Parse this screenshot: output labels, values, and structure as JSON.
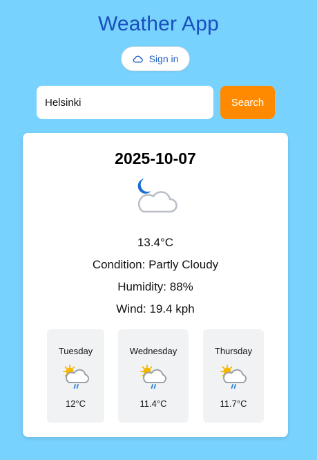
{
  "app": {
    "title": "Weather App",
    "signin_label": "Sign in"
  },
  "search": {
    "value": "Helsinki",
    "button_label": "Search"
  },
  "current": {
    "date": "2025-10-07",
    "icon": "moon-cloud-icon",
    "temperature": "13.4°C",
    "condition": "Condition: Partly Cloudy",
    "humidity": "Humidity: 88%",
    "wind": "Wind: 19.4 kph"
  },
  "forecast": [
    {
      "day": "Tuesday",
      "temp": "12°C",
      "icon": "sun-cloud-rain-icon"
    },
    {
      "day": "Wednesday",
      "temp": "11.4°C",
      "icon": "sun-cloud-rain-icon"
    },
    {
      "day": "Thursday",
      "temp": "11.7°C",
      "icon": "sun-cloud-rain-icon"
    }
  ],
  "colors": {
    "background": "#77d2fd",
    "title": "#1a4fbf",
    "search_button": "#ff8a00",
    "card": "#ffffff",
    "forecast_card": "#f1f2f4"
  }
}
